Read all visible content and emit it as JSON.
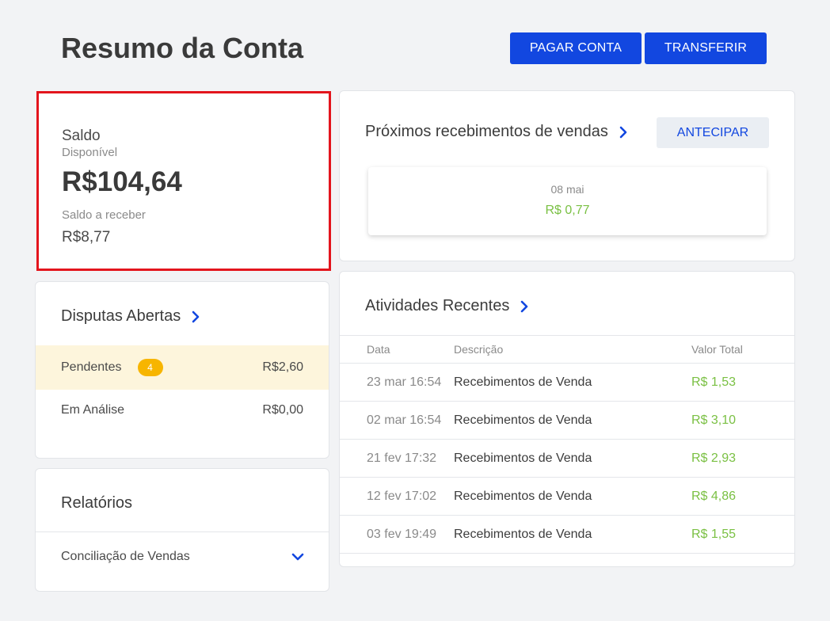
{
  "header": {
    "title": "Resumo da Conta",
    "pay_label": "PAGAR CONTA",
    "transfer_label": "TRANSFERIR"
  },
  "balance": {
    "label": "Saldo",
    "sub_label": "Disponível",
    "value": "R$104,64",
    "receivable_label": "Saldo a receber",
    "receivable_value": "R$8,77"
  },
  "disputes": {
    "title": "Disputas Abertas",
    "rows": [
      {
        "label": "Pendentes",
        "badge": "4",
        "amount": "R$2,60"
      },
      {
        "label": "Em Análise",
        "amount": "R$0,00"
      }
    ]
  },
  "reports": {
    "title": "Relatórios",
    "item": "Conciliação de Vendas"
  },
  "upcoming": {
    "title": "Próximos recebimentos de vendas",
    "button_label": "ANTECIPAR",
    "tile": {
      "date": "08 mai",
      "amount": "R$ 0,77"
    }
  },
  "activities": {
    "title": "Atividades Recentes",
    "columns": [
      "Data",
      "Descrição",
      "Valor Total"
    ],
    "rows": [
      {
        "date": "23 mar 16:54",
        "desc": "Recebimentos de Venda",
        "value": "R$ 1,53"
      },
      {
        "date": "02 mar 16:54",
        "desc": "Recebimentos de Venda",
        "value": "R$ 3,10"
      },
      {
        "date": "21 fev 17:32",
        "desc": "Recebimentos de Venda",
        "value": "R$ 2,93"
      },
      {
        "date": "12 fev 17:02",
        "desc": "Recebimentos de Venda",
        "value": "R$ 4,86"
      },
      {
        "date": "03 fev 19:49",
        "desc": "Recebimentos de Venda",
        "value": "R$ 1,55"
      }
    ]
  },
  "colors": {
    "primary": "#1247e0",
    "positive": "#7ac043",
    "badge": "#f7b500",
    "pending_bg": "#fdf5dc",
    "highlight_border": "#e3151d"
  },
  "icons": {
    "heading_link": "chevron-right-icon",
    "reports_expand": "chevron-down-icon"
  }
}
